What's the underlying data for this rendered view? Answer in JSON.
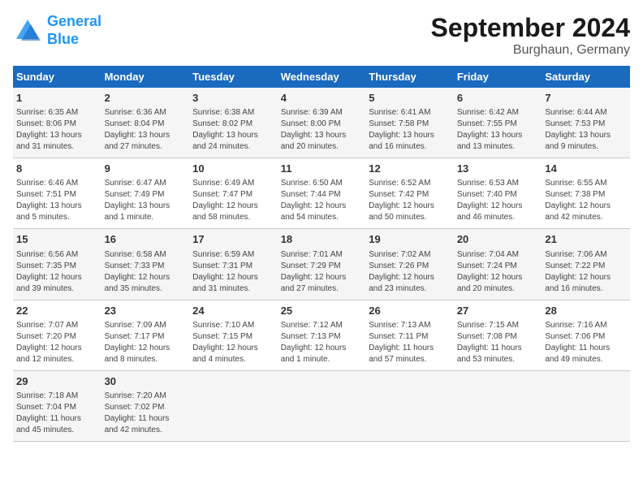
{
  "header": {
    "logo_line1": "General",
    "logo_line2": "Blue",
    "month": "September 2024",
    "location": "Burghaun, Germany"
  },
  "columns": [
    "Sunday",
    "Monday",
    "Tuesday",
    "Wednesday",
    "Thursday",
    "Friday",
    "Saturday"
  ],
  "weeks": [
    [
      {
        "day": "1",
        "info": "Sunrise: 6:35 AM\nSunset: 8:06 PM\nDaylight: 13 hours\nand 31 minutes."
      },
      {
        "day": "2",
        "info": "Sunrise: 6:36 AM\nSunset: 8:04 PM\nDaylight: 13 hours\nand 27 minutes."
      },
      {
        "day": "3",
        "info": "Sunrise: 6:38 AM\nSunset: 8:02 PM\nDaylight: 13 hours\nand 24 minutes."
      },
      {
        "day": "4",
        "info": "Sunrise: 6:39 AM\nSunset: 8:00 PM\nDaylight: 13 hours\nand 20 minutes."
      },
      {
        "day": "5",
        "info": "Sunrise: 6:41 AM\nSunset: 7:58 PM\nDaylight: 13 hours\nand 16 minutes."
      },
      {
        "day": "6",
        "info": "Sunrise: 6:42 AM\nSunset: 7:55 PM\nDaylight: 13 hours\nand 13 minutes."
      },
      {
        "day": "7",
        "info": "Sunrise: 6:44 AM\nSunset: 7:53 PM\nDaylight: 13 hours\nand 9 minutes."
      }
    ],
    [
      {
        "day": "8",
        "info": "Sunrise: 6:46 AM\nSunset: 7:51 PM\nDaylight: 13 hours\nand 5 minutes."
      },
      {
        "day": "9",
        "info": "Sunrise: 6:47 AM\nSunset: 7:49 PM\nDaylight: 13 hours\nand 1 minute."
      },
      {
        "day": "10",
        "info": "Sunrise: 6:49 AM\nSunset: 7:47 PM\nDaylight: 12 hours\nand 58 minutes."
      },
      {
        "day": "11",
        "info": "Sunrise: 6:50 AM\nSunset: 7:44 PM\nDaylight: 12 hours\nand 54 minutes."
      },
      {
        "day": "12",
        "info": "Sunrise: 6:52 AM\nSunset: 7:42 PM\nDaylight: 12 hours\nand 50 minutes."
      },
      {
        "day": "13",
        "info": "Sunrise: 6:53 AM\nSunset: 7:40 PM\nDaylight: 12 hours\nand 46 minutes."
      },
      {
        "day": "14",
        "info": "Sunrise: 6:55 AM\nSunset: 7:38 PM\nDaylight: 12 hours\nand 42 minutes."
      }
    ],
    [
      {
        "day": "15",
        "info": "Sunrise: 6:56 AM\nSunset: 7:35 PM\nDaylight: 12 hours\nand 39 minutes."
      },
      {
        "day": "16",
        "info": "Sunrise: 6:58 AM\nSunset: 7:33 PM\nDaylight: 12 hours\nand 35 minutes."
      },
      {
        "day": "17",
        "info": "Sunrise: 6:59 AM\nSunset: 7:31 PM\nDaylight: 12 hours\nand 31 minutes."
      },
      {
        "day": "18",
        "info": "Sunrise: 7:01 AM\nSunset: 7:29 PM\nDaylight: 12 hours\nand 27 minutes."
      },
      {
        "day": "19",
        "info": "Sunrise: 7:02 AM\nSunset: 7:26 PM\nDaylight: 12 hours\nand 23 minutes."
      },
      {
        "day": "20",
        "info": "Sunrise: 7:04 AM\nSunset: 7:24 PM\nDaylight: 12 hours\nand 20 minutes."
      },
      {
        "day": "21",
        "info": "Sunrise: 7:06 AM\nSunset: 7:22 PM\nDaylight: 12 hours\nand 16 minutes."
      }
    ],
    [
      {
        "day": "22",
        "info": "Sunrise: 7:07 AM\nSunset: 7:20 PM\nDaylight: 12 hours\nand 12 minutes."
      },
      {
        "day": "23",
        "info": "Sunrise: 7:09 AM\nSunset: 7:17 PM\nDaylight: 12 hours\nand 8 minutes."
      },
      {
        "day": "24",
        "info": "Sunrise: 7:10 AM\nSunset: 7:15 PM\nDaylight: 12 hours\nand 4 minutes."
      },
      {
        "day": "25",
        "info": "Sunrise: 7:12 AM\nSunset: 7:13 PM\nDaylight: 12 hours\nand 1 minute."
      },
      {
        "day": "26",
        "info": "Sunrise: 7:13 AM\nSunset: 7:11 PM\nDaylight: 11 hours\nand 57 minutes."
      },
      {
        "day": "27",
        "info": "Sunrise: 7:15 AM\nSunset: 7:08 PM\nDaylight: 11 hours\nand 53 minutes."
      },
      {
        "day": "28",
        "info": "Sunrise: 7:16 AM\nSunset: 7:06 PM\nDaylight: 11 hours\nand 49 minutes."
      }
    ],
    [
      {
        "day": "29",
        "info": "Sunrise: 7:18 AM\nSunset: 7:04 PM\nDaylight: 11 hours\nand 45 minutes."
      },
      {
        "day": "30",
        "info": "Sunrise: 7:20 AM\nSunset: 7:02 PM\nDaylight: 11 hours\nand 42 minutes."
      },
      {
        "day": "",
        "info": ""
      },
      {
        "day": "",
        "info": ""
      },
      {
        "day": "",
        "info": ""
      },
      {
        "day": "",
        "info": ""
      },
      {
        "day": "",
        "info": ""
      }
    ]
  ]
}
